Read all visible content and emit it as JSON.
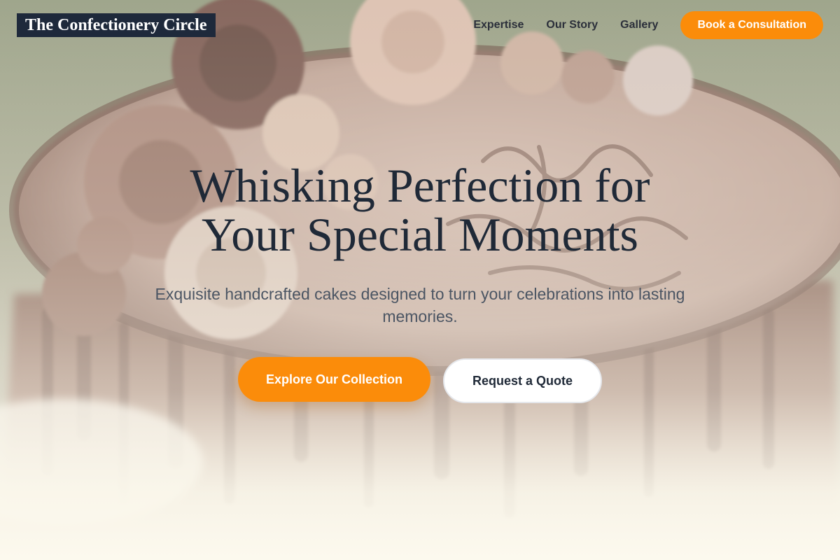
{
  "header": {
    "brand": "The Confectionery Circle",
    "nav": [
      {
        "label": "Expertise"
      },
      {
        "label": "Our Story"
      },
      {
        "label": "Gallery"
      }
    ],
    "cta_label": "Book a Consultation"
  },
  "hero": {
    "title": "Whisking Perfection for Your Special Moments",
    "subtitle": "Exquisite handcrafted cakes designed to turn your celebrations into lasting memories.",
    "primary_label": "Explore Our Collection",
    "secondary_label": "Request a Quote",
    "background_image": "chocolate-birthday-cake-photo"
  },
  "colors": {
    "accent": "#fb8c0a",
    "brand_bg": "#1e293b",
    "heading": "#1f2937",
    "body_text": "#4b5563"
  }
}
